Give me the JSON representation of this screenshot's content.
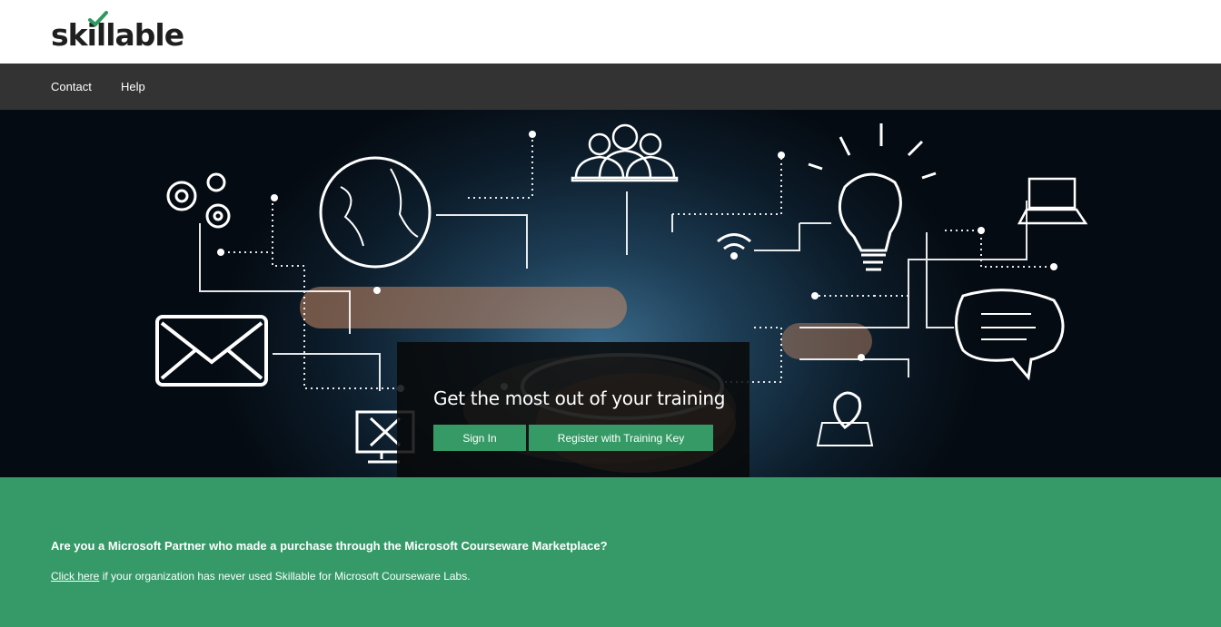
{
  "brand": {
    "name": "skillable",
    "accent_color": "#2e9a5f"
  },
  "nav": {
    "items": [
      {
        "label": "Contact"
      },
      {
        "label": "Help"
      }
    ]
  },
  "hero": {
    "title": "Get the most out of your training",
    "sign_in_label": "Sign In",
    "register_label": "Register with Training Key",
    "button_color": "#359a65"
  },
  "partner": {
    "question": "Are you a Microsoft Partner who made a purchase through the Microsoft Courseware Marketplace?",
    "link_text": "Click here",
    "line_rest": " if your organization has never used Skillable for Microsoft Courseware Labs.",
    "band_color": "#359a68"
  },
  "icons": [
    "gears-icon",
    "globe-icon",
    "people-icon",
    "lightbulb-icon",
    "laptop-icon",
    "envelope-icon",
    "chat-bubble-icon",
    "monitor-tools-icon",
    "map-pin-icon",
    "wifi-icon"
  ]
}
